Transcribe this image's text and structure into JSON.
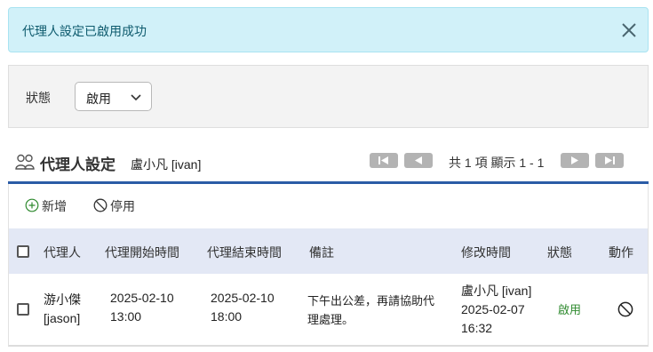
{
  "alert": {
    "message": "代理人設定已啟用成功",
    "close_icon": "close-icon"
  },
  "filter": {
    "label": "狀態",
    "select_value": "啟用"
  },
  "section": {
    "title": "代理人設定",
    "user": "盧小凡 [ivan]"
  },
  "pagination": {
    "info": "共 1 項 顯示 1 - 1"
  },
  "toolbar": {
    "add_label": "新增",
    "disable_label": "停用"
  },
  "table": {
    "headers": [
      "代理人",
      "代理開始時間",
      "代理結束時間",
      "備註",
      "修改時間",
      "狀態",
      "動作"
    ],
    "rows": [
      {
        "agent_name": "游小傑",
        "agent_id": "[jason]",
        "start_date": "2025-02-10",
        "start_time": "13:00",
        "end_date": "2025-02-10",
        "end_time": "18:00",
        "note_line1": "下午出公差，再請協助代",
        "note_line2": "理處理。",
        "modified_by": "盧小凡 [ivan]",
        "modified_date": "2025-02-07",
        "modified_time": "16:32",
        "status": "啟用"
      }
    ]
  },
  "colors": {
    "alert_bg": "#d1f1f9",
    "accent_blue": "#2b5ca6",
    "status_green": "#2f8a2f"
  }
}
